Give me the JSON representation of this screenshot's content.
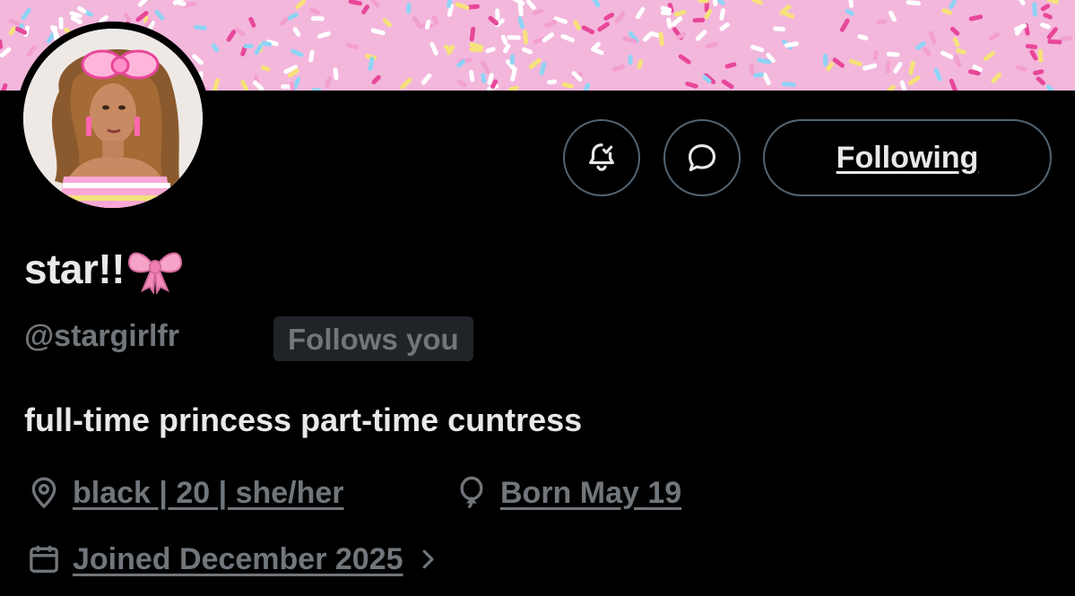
{
  "profile": {
    "display_name": "star!!",
    "handle": "@stargirlfr",
    "follows_you_label": "Follows you",
    "bio": "full-time princess part-time cuntress",
    "location": "black | 20 | she/her",
    "birthday": "Born May 19",
    "joined": "Joined December 2025",
    "name_emoji_icon": "pink-bow-icon"
  },
  "actions": {
    "notify_icon": "bell-icon",
    "message_icon": "message-icon",
    "follow_label": "Following"
  },
  "colors": {
    "banner": "#f3b7dc",
    "background": "#000000",
    "primary_text": "#e7e9ea",
    "secondary_text": "#71767b",
    "border": "#536471",
    "badge_bg": "#202327"
  }
}
